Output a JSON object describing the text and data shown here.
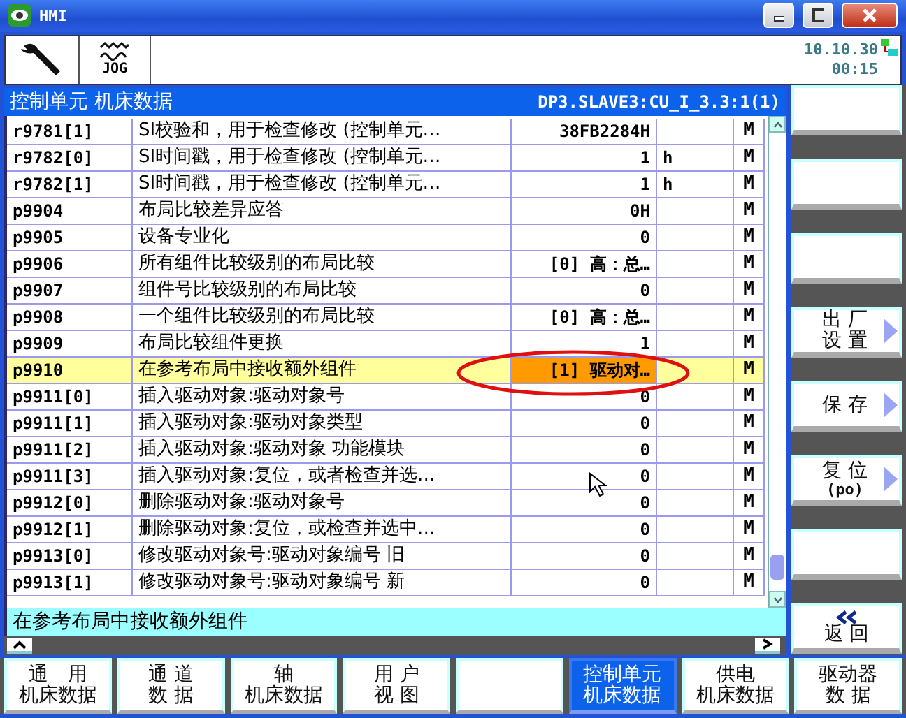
{
  "window": {
    "title": "HMI"
  },
  "toolbar": {
    "mode_label": "JOG",
    "date": "10.10.30",
    "time": "00:15"
  },
  "header": {
    "title": "控制单元 机床数据",
    "path": "DP3.SLAVE3:CU_I_3.3:1(1)"
  },
  "rows": [
    {
      "param": "r9781[1]",
      "description": "SI校验和，用于检查修改 (控制单元…",
      "value": "38FB2284H",
      "unit": "",
      "access": "M",
      "selected": false
    },
    {
      "param": "r9782[0]",
      "description": "SI时间戳，用于检查修改 (控制单元…",
      "value": "1",
      "unit": "h",
      "access": "M",
      "selected": false
    },
    {
      "param": "r9782[1]",
      "description": "SI时间戳，用于检查修改 (控制单元…",
      "value": "1",
      "unit": "h",
      "access": "M",
      "selected": false
    },
    {
      "param": "p9904",
      "description": "布局比较差异应答",
      "value": "0H",
      "unit": "",
      "access": "M",
      "selected": false
    },
    {
      "param": "p9905",
      "description": "设备专业化",
      "value": "0",
      "unit": "",
      "access": "M",
      "selected": false
    },
    {
      "param": "p9906",
      "description": "所有组件比较级别的布局比较",
      "value": "[0] 高：总…",
      "unit": "",
      "access": "M",
      "selected": false
    },
    {
      "param": "p9907",
      "description": "组件号比较级别的布局比较",
      "value": "0",
      "unit": "",
      "access": "M",
      "selected": false
    },
    {
      "param": "p9908",
      "description": "一个组件比较级别的布局比较",
      "value": "[0] 高：总…",
      "unit": "",
      "access": "M",
      "selected": false
    },
    {
      "param": "p9909",
      "description": "布局比较组件更换",
      "value": "1",
      "unit": "",
      "access": "M",
      "selected": false
    },
    {
      "param": "p9910",
      "description": "在参考布局中接收额外组件",
      "value": "[1] 驱动对…",
      "unit": "",
      "access": "M",
      "selected": true
    },
    {
      "param": "p9911[0]",
      "description": "插入驱动对象:驱动对象号",
      "value": "0",
      "unit": "",
      "access": "M",
      "selected": false
    },
    {
      "param": "p9911[1]",
      "description": "插入驱动对象:驱动对象类型",
      "value": "0",
      "unit": "",
      "access": "M",
      "selected": false
    },
    {
      "param": "p9911[2]",
      "description": "插入驱动对象:驱动对象 功能模块",
      "value": "0",
      "unit": "",
      "access": "M",
      "selected": false
    },
    {
      "param": "p9911[3]",
      "description": "插入驱动对象:复位，或者检查并选…",
      "value": "0",
      "unit": "",
      "access": "M",
      "selected": false
    },
    {
      "param": "p9912[0]",
      "description": "删除驱动对象:驱动对象号",
      "value": "0",
      "unit": "",
      "access": "M",
      "selected": false
    },
    {
      "param": "p9912[1]",
      "description": "删除驱动对象:复位，或检查并选中…",
      "value": "0",
      "unit": "",
      "access": "M",
      "selected": false
    },
    {
      "param": "p9913[0]",
      "description": "修改驱动对象号:驱动对象编号 旧",
      "value": "0",
      "unit": "",
      "access": "M",
      "selected": false
    },
    {
      "param": "p9913[1]",
      "description": "修改驱动对象号:驱动对象编号 新",
      "value": "0",
      "unit": "",
      "access": "M",
      "selected": false
    }
  ],
  "description_bar": "在参考布局中接收额外组件",
  "side_softkeys": [
    {
      "kind": "blank"
    },
    {
      "kind": "blank"
    },
    {
      "kind": "blank"
    },
    {
      "kind": "menu",
      "lines": [
        "出 厂",
        "设 置"
      ]
    },
    {
      "kind": "menu",
      "lines": [
        "保 存"
      ]
    },
    {
      "kind": "menu",
      "lines": [
        "复 位"
      ],
      "sub": "(po)"
    },
    {
      "kind": "blank"
    },
    {
      "kind": "back",
      "lines": [
        "返 回"
      ]
    }
  ],
  "bottom_softkeys": [
    {
      "kind": "text",
      "lines": [
        "通　用",
        "机床数据"
      ],
      "selected": false
    },
    {
      "kind": "text",
      "lines": [
        "通 道",
        "数 据"
      ],
      "selected": false
    },
    {
      "kind": "text",
      "lines": [
        "轴",
        "机床数据"
      ],
      "selected": false
    },
    {
      "kind": "text",
      "lines": [
        "用 户",
        "视 图"
      ],
      "selected": false
    },
    {
      "kind": "blank",
      "selected": false
    },
    {
      "kind": "text",
      "lines": [
        "控制单元",
        "机床数据"
      ],
      "selected": true
    },
    {
      "kind": "text",
      "lines": [
        "供电",
        "机床数据"
      ],
      "selected": false
    },
    {
      "kind": "text",
      "lines": [
        "驱动器",
        "数 据"
      ],
      "selected": false
    }
  ]
}
